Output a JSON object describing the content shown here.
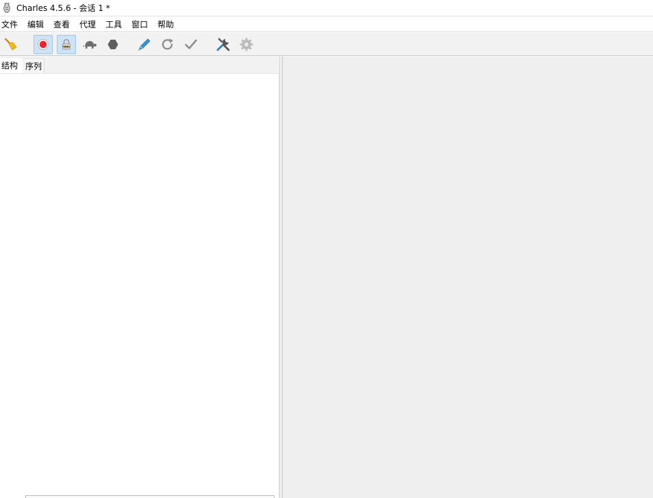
{
  "window": {
    "title": "Charles 4.5.6 - 会话 1 *",
    "icon": "charles-vase-icon"
  },
  "menubar": {
    "items": [
      "文件",
      "编辑",
      "查看",
      "代理",
      "工具",
      "窗口",
      "帮助"
    ]
  },
  "toolbar": {
    "buttons": [
      {
        "icon": "broom-clear-icon",
        "active": false
      },
      {
        "icon": "record-icon",
        "active": true,
        "color": "#e8242f"
      },
      {
        "icon": "ssl-lock-icon",
        "active": true
      },
      {
        "icon": "turtle-throttle-icon",
        "active": false
      },
      {
        "icon": "stop-hexagon-icon",
        "active": false
      },
      {
        "icon": "compose-pen-icon",
        "active": false
      },
      {
        "icon": "repeat-icon",
        "active": false
      },
      {
        "icon": "validate-check-icon",
        "active": false
      },
      {
        "icon": "tools-icon",
        "active": false
      },
      {
        "icon": "settings-gear-icon",
        "active": false
      }
    ]
  },
  "left_pane": {
    "tabs": [
      {
        "label": "结构",
        "selected": true
      },
      {
        "label": "序列",
        "selected": false
      }
    ]
  },
  "colors": {
    "toolbar_bg": "#f2f2f2",
    "active_button_bg": "#cfe3f7",
    "right_pane_bg": "#efefef",
    "record_red": "#e8242f"
  }
}
